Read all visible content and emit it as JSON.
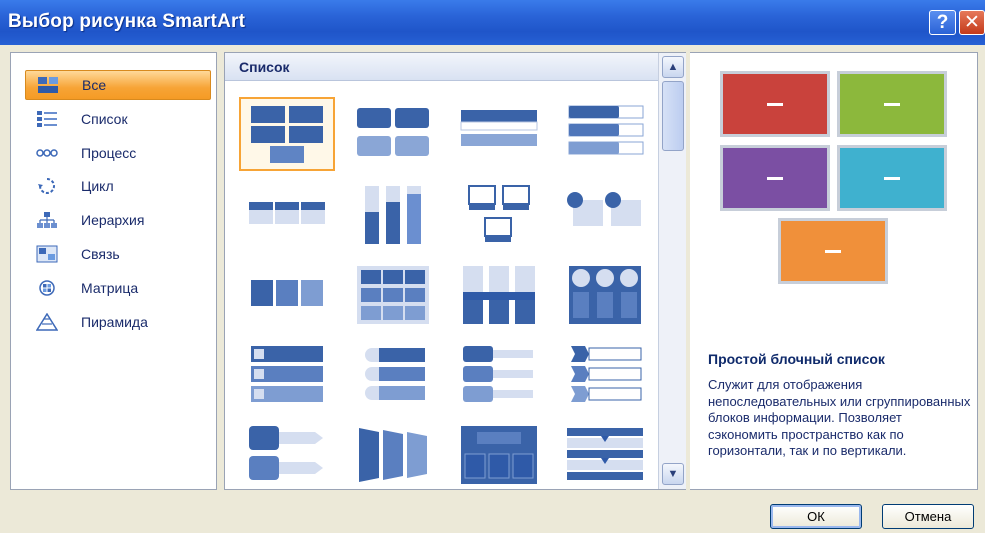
{
  "window": {
    "title": "Выбор рисунка SmartArt",
    "help_glyph": "?",
    "close_glyph": "✕"
  },
  "categories": [
    {
      "label": "Все",
      "icon": "all-icon",
      "selected": true
    },
    {
      "label": "Список",
      "icon": "list-icon",
      "selected": false
    },
    {
      "label": "Процесс",
      "icon": "process-icon",
      "selected": false
    },
    {
      "label": "Цикл",
      "icon": "cycle-icon",
      "selected": false
    },
    {
      "label": "Иерархия",
      "icon": "hierarchy-icon",
      "selected": false
    },
    {
      "label": "Связь",
      "icon": "relationship-icon",
      "selected": false
    },
    {
      "label": "Матрица",
      "icon": "matrix-icon",
      "selected": false
    },
    {
      "label": "Пирамида",
      "icon": "pyramid-icon",
      "selected": false
    }
  ],
  "gallery": {
    "header": "Список",
    "selected_index": 0,
    "scroll_up_glyph": "▲",
    "scroll_down_glyph": "▼"
  },
  "preview": {
    "colors": [
      "#c9423c",
      "#8cb83c",
      "#7b4fa3",
      "#3fb1cf",
      "#f0903a"
    ],
    "title": "Простой блочный список",
    "description": "Служит для отображения непоследовательных или сгруппированных блоков информации. Позволяет сэкономить пространство как по горизонтали, так и по вертикали."
  },
  "buttons": {
    "ok": "ОК",
    "cancel": "Отмена"
  }
}
